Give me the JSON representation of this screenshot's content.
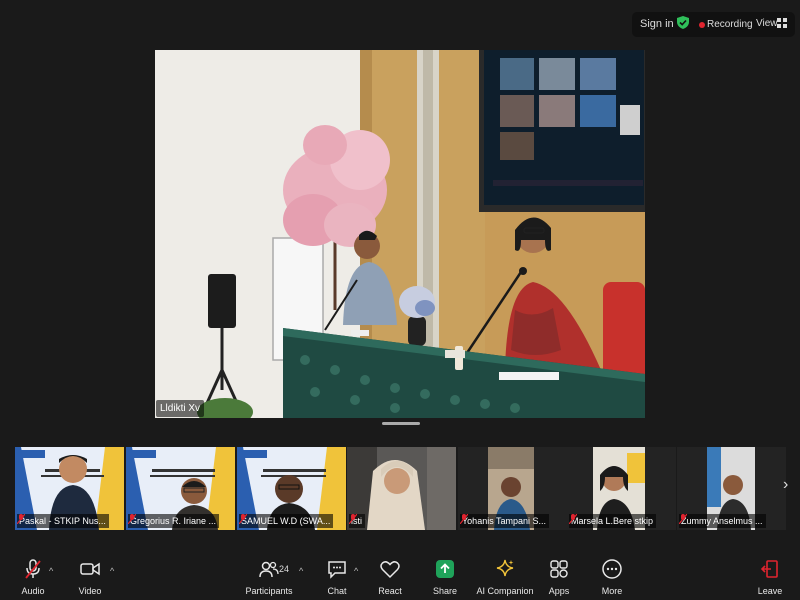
{
  "topbar": {
    "sign_in": "Sign in",
    "recording": "Recording",
    "view": "View"
  },
  "main_video": {
    "name": "Lldikti Xv"
  },
  "participants": [
    {
      "name": "Paskal - STKIP Nus..."
    },
    {
      "name": "Gregorius R. Iriane ..."
    },
    {
      "name": "SAMUEL W.D (SWA..."
    },
    {
      "name": "isti"
    },
    {
      "name": "Yohanis Tampani S..."
    },
    {
      "name": "Marsela L.Bere stkip"
    },
    {
      "name": "Zummy Anselmus ..."
    }
  ],
  "toolbar": {
    "audio": "Audio",
    "video": "Video",
    "participants": "Participants",
    "participant_count": "24",
    "chat": "Chat",
    "react": "React",
    "share": "Share",
    "ai_companion": "AI Companion",
    "apps": "Apps",
    "more": "More",
    "leave": "Leave"
  },
  "colors": {
    "share_green": "#1fa35a",
    "leave_red": "#e0242f",
    "secure_green": "#2fbf5a"
  }
}
